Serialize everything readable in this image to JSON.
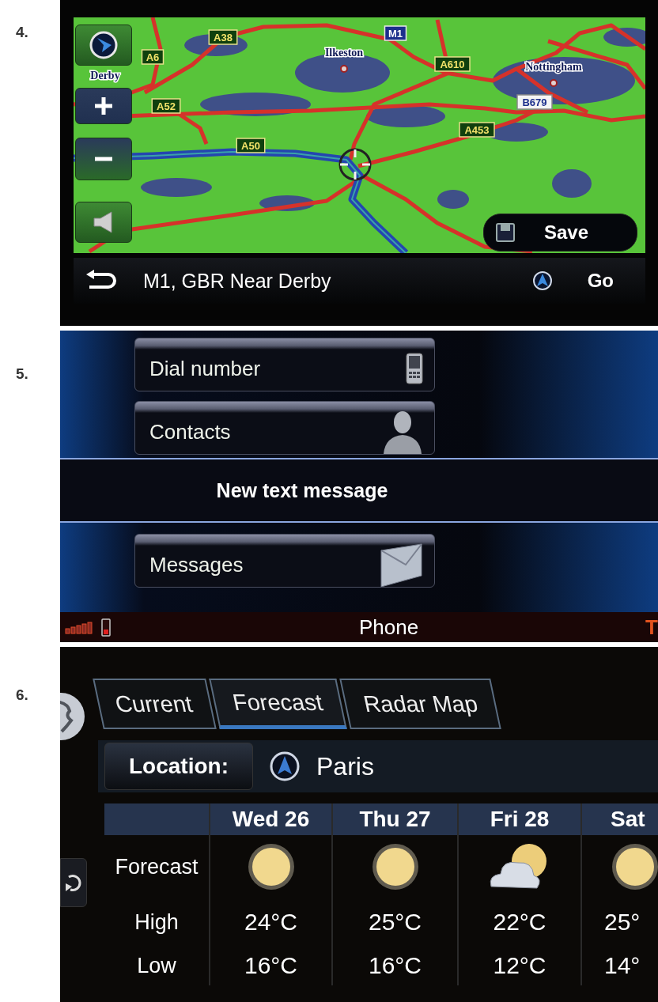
{
  "map_screen": {
    "step": "4.",
    "place_names": [
      {
        "label": "Ilkeston",
        "marker": true
      },
      {
        "label": "Nottingham",
        "marker": true
      },
      {
        "label": "Derby",
        "marker": false
      }
    ],
    "road_signs": [
      {
        "label": "A38",
        "kind": "primary"
      },
      {
        "label": "A6",
        "kind": "primary"
      },
      {
        "label": "M1",
        "kind": "motorway"
      },
      {
        "label": "A610",
        "kind": "primary"
      },
      {
        "label": "B679",
        "kind": "secondary"
      },
      {
        "label": "A52",
        "kind": "primary"
      },
      {
        "label": "A453",
        "kind": "primary"
      },
      {
        "label": "A50",
        "kind": "primary"
      }
    ],
    "save_button": "Save",
    "location": "M1, GBR Near Derby",
    "go_button": "Go"
  },
  "phone_screen": {
    "step": "5.",
    "menu": [
      {
        "label": "Dial number",
        "kind": "phone"
      },
      {
        "label": "Contacts",
        "kind": "person"
      },
      {
        "label": "New text message",
        "kind": "banner"
      },
      {
        "label": "Messages",
        "kind": "envelope"
      }
    ],
    "status_bar": {
      "title": "Phone",
      "right_text": "T"
    }
  },
  "weather_screen": {
    "step": "6.",
    "tabs": [
      {
        "label": "Current",
        "selected": false
      },
      {
        "label": "Forecast",
        "selected": true
      },
      {
        "label": "Radar Map",
        "selected": false
      }
    ],
    "location_label": "Location:",
    "location": "Paris",
    "row_labels": [
      "Forecast",
      "High",
      "Low"
    ],
    "days": [
      {
        "label": "Wed 26",
        "kind": "sunny",
        "high": "24°C",
        "low": "16°C"
      },
      {
        "label": "Thu 27",
        "kind": "sunny",
        "high": "25°C",
        "low": "16°C"
      },
      {
        "label": "Fri 28",
        "kind": "cloudy",
        "high": "22°C",
        "low": "12°C"
      },
      {
        "label": "Sat",
        "kind": "sunny",
        "high": "25°",
        "low": "14°"
      }
    ]
  }
}
